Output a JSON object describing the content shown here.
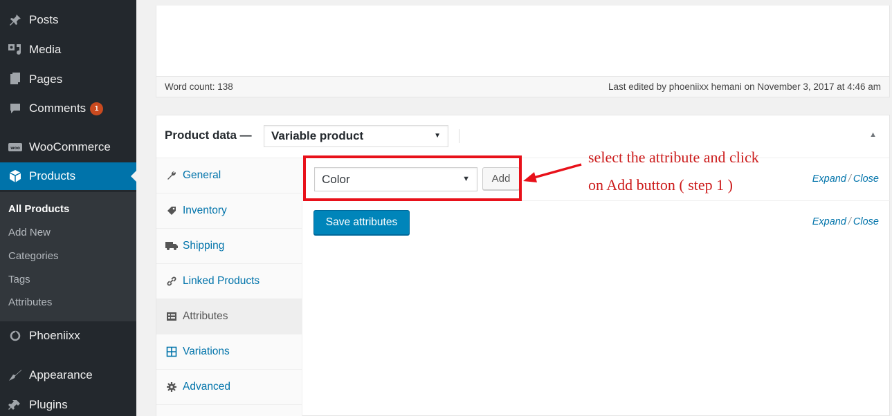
{
  "sidebar": {
    "menu": [
      {
        "label": "Posts",
        "icon": "pin-icon"
      },
      {
        "label": "Media",
        "icon": "media-icon"
      },
      {
        "label": "Pages",
        "icon": "pages-icon"
      },
      {
        "label": "Comments",
        "icon": "comments-icon",
        "badge": "1"
      },
      {
        "label": "WooCommerce",
        "icon": "woocommerce-icon"
      },
      {
        "label": "Products",
        "icon": "products-icon",
        "current": true
      },
      {
        "label": "Phoeniixx",
        "icon": "phoeniixx-icon"
      },
      {
        "label": "Appearance",
        "icon": "appearance-icon"
      },
      {
        "label": "Plugins",
        "icon": "plugins-icon"
      }
    ],
    "submenu": [
      {
        "label": "All Products",
        "current": true
      },
      {
        "label": "Add New"
      },
      {
        "label": "Categories"
      },
      {
        "label": "Tags"
      },
      {
        "label": "Attributes"
      }
    ]
  },
  "editor": {
    "word_count": "Word count: 138",
    "last_edited": "Last edited by phoeniixx hemani on November 3, 2017 at 4:46 am"
  },
  "product_data": {
    "title": "Product data —",
    "type_value": "Variable product",
    "tabs": [
      {
        "label": "General",
        "icon": "wrench-icon"
      },
      {
        "label": "Inventory",
        "icon": "tag-icon"
      },
      {
        "label": "Shipping",
        "icon": "truck-icon"
      },
      {
        "label": "Linked Products",
        "icon": "link-icon"
      },
      {
        "label": "Attributes",
        "icon": "list-icon",
        "active": true
      },
      {
        "label": "Variations",
        "icon": "grid-icon"
      },
      {
        "label": "Advanced",
        "icon": "gear-icon"
      }
    ],
    "attribute_select_value": "Color",
    "add_label": "Add",
    "expand_label": "Expand",
    "close_label": "Close",
    "save_label": "Save attributes"
  },
  "annotation": {
    "line1": "select the attribute and click",
    "line2": "on Add button ( step 1 )",
    "color": "#e8111a"
  }
}
